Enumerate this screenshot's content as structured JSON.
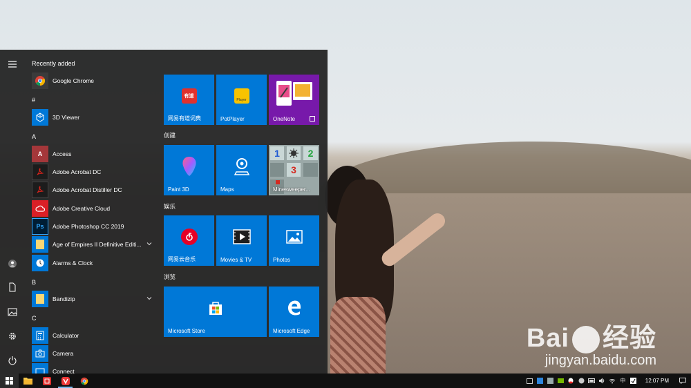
{
  "start_menu": {
    "sections": [
      {
        "header": "Recently added",
        "items": [
          {
            "label": "Google Chrome",
            "icon": "chrome-icon"
          }
        ]
      },
      {
        "header": "#",
        "items": [
          {
            "label": "3D Viewer",
            "icon": "cube-icon"
          }
        ]
      },
      {
        "header": "A",
        "items": [
          {
            "label": "Access",
            "icon": "access-icon"
          },
          {
            "label": "Adobe Acrobat DC",
            "icon": "acrobat-icon"
          },
          {
            "label": "Adobe Acrobat Distiller DC",
            "icon": "acrobat-distiller-icon"
          },
          {
            "label": "Adobe Creative Cloud",
            "icon": "creative-cloud-icon"
          },
          {
            "label": "Adobe Photoshop CC 2019",
            "icon": "photoshop-icon"
          },
          {
            "label": "Age of Empires II Definitive Editi...",
            "icon": "folder-icon"
          },
          {
            "label": "Alarms & Clock",
            "icon": "alarm-clock-icon"
          }
        ]
      },
      {
        "header": "B",
        "items": [
          {
            "label": "Bandizip",
            "icon": "folder-icon"
          }
        ]
      },
      {
        "header": "C",
        "items": [
          {
            "label": "Calculator",
            "icon": "calculator-icon"
          },
          {
            "label": "Camera",
            "icon": "camera-icon"
          },
          {
            "label": "Connect",
            "icon": "connect-icon"
          }
        ]
      }
    ],
    "tile_groups": [
      {
        "title": "",
        "tiles": [
          {
            "label": "网易有道词典",
            "icon": "youdao-icon",
            "badge": "有道"
          },
          {
            "label": "PotPlayer",
            "icon": "potplayer-icon",
            "badge": "Player"
          },
          {
            "label": "OneNote",
            "icon": "onenote-icon"
          }
        ]
      },
      {
        "title": "创建",
        "tiles": [
          {
            "label": "Paint 3D",
            "icon": "paint3d-icon"
          },
          {
            "label": "Maps",
            "icon": "maps-icon"
          },
          {
            "label": "Minesweeper...",
            "icon": "minesweeper-icon",
            "numbers": [
              "1",
              "2",
              "3"
            ]
          }
        ]
      },
      {
        "title": "娱乐",
        "tiles": [
          {
            "label": "网易云音乐",
            "icon": "netease-music-icon"
          },
          {
            "label": "Movies & TV",
            "icon": "movies-tv-icon"
          },
          {
            "label": "Photos",
            "icon": "photos-icon"
          }
        ]
      },
      {
        "title": "浏览",
        "tiles": [
          {
            "label": "Microsoft Store",
            "icon": "store-icon"
          },
          {
            "label": "Microsoft Edge",
            "icon": "edge-icon"
          }
        ]
      }
    ]
  },
  "taskbar": {
    "clock": "12:07 PM",
    "ime": "中"
  },
  "watermark": {
    "logo_left": "Bai",
    "logo_right": "经验",
    "url": "jingyan.baidu.com"
  },
  "colors": {
    "tile_blue": "#0078d7",
    "onenote_purple": "#7719aa",
    "menu_bg": "#282828",
    "taskbar_bg": "#111111"
  }
}
